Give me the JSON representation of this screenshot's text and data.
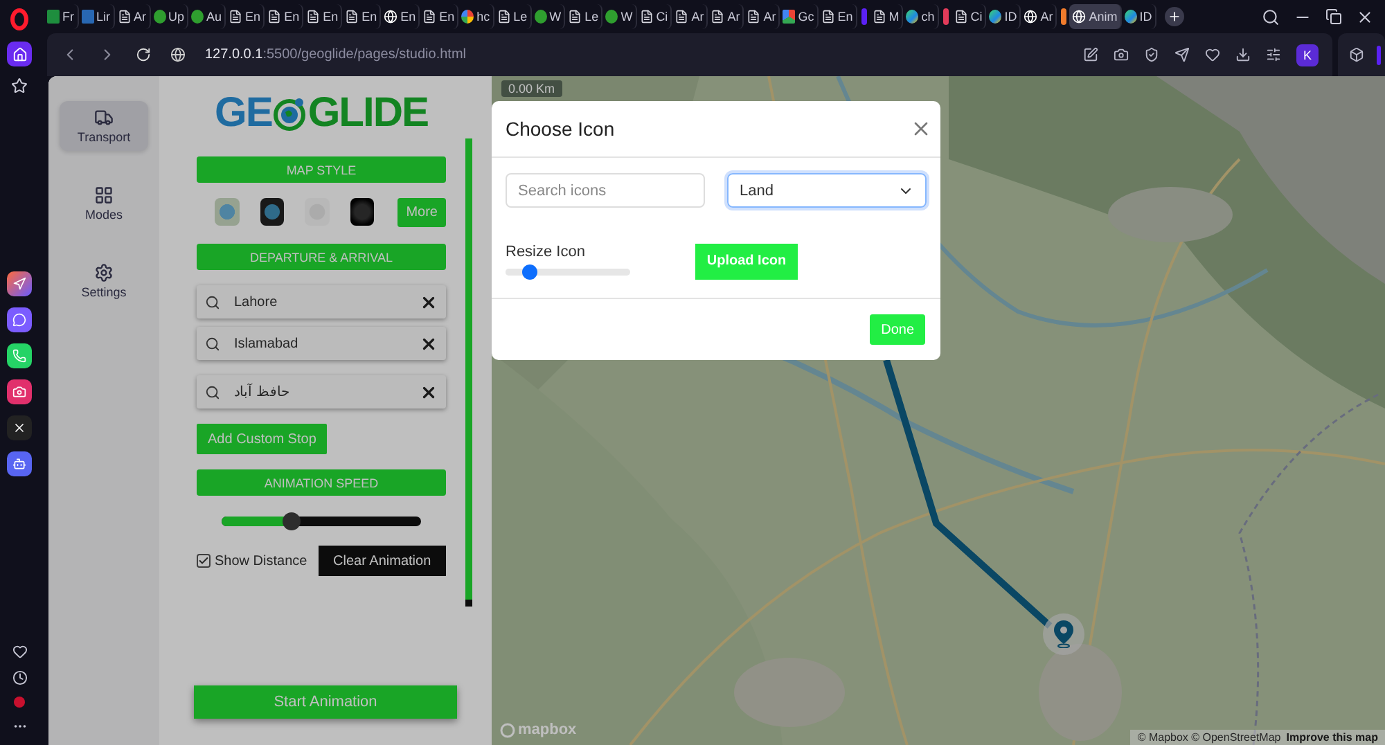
{
  "browser": {
    "tabs": [
      {
        "label": "Fr",
        "kind": "sheet",
        "selected": false
      },
      {
        "label": "Lir",
        "kind": "linkedin",
        "selected": false
      },
      {
        "label": "Ar",
        "kind": "doc",
        "selected": false
      },
      {
        "label": "Up",
        "kind": "upwork",
        "selected": false
      },
      {
        "label": "Au",
        "kind": "upwork",
        "selected": false
      },
      {
        "label": "En",
        "kind": "doc",
        "selected": false
      },
      {
        "label": "En",
        "kind": "doc",
        "selected": false
      },
      {
        "label": "En",
        "kind": "doc",
        "selected": false
      },
      {
        "label": "En",
        "kind": "doc",
        "selected": false
      },
      {
        "label": "En",
        "kind": "globe",
        "selected": false
      },
      {
        "label": "En",
        "kind": "doc",
        "selected": false
      },
      {
        "label": "hc",
        "kind": "google",
        "selected": false
      },
      {
        "label": "Le",
        "kind": "doc",
        "selected": false
      },
      {
        "label": "W",
        "kind": "upwork",
        "selected": false
      },
      {
        "label": "Le",
        "kind": "doc",
        "selected": false
      },
      {
        "label": "W",
        "kind": "upwork",
        "selected": false
      },
      {
        "label": "Ci",
        "kind": "doc",
        "selected": false
      },
      {
        "label": "Ar",
        "kind": "doc",
        "selected": false
      },
      {
        "label": "Ar",
        "kind": "doc",
        "selected": false
      },
      {
        "label": "Ar",
        "kind": "doc",
        "selected": false
      },
      {
        "label": "Gc",
        "kind": "colorful",
        "selected": false
      },
      {
        "label": "En",
        "kind": "doc",
        "selected": false
      },
      {
        "label": "M",
        "kind": "doc",
        "selected": false,
        "color": "#5b21f5"
      },
      {
        "label": "ch",
        "kind": "edge",
        "selected": false
      },
      {
        "label": "Ci",
        "kind": "doc",
        "selected": false,
        "color": "#e23b5a"
      },
      {
        "label": "ID",
        "kind": "edge",
        "selected": false
      },
      {
        "label": "Ar",
        "kind": "globe",
        "selected": false
      },
      {
        "label": "Anim",
        "kind": "globe",
        "selected": true,
        "color": "#f07b2c"
      },
      {
        "label": "ID",
        "kind": "edge",
        "selected": false
      }
    ],
    "url_host": "127.0.0.1",
    "url_rest": ":5500/geoglide/pages/studio.html",
    "profile": "K"
  },
  "nav": [
    {
      "label": "Transport",
      "kind": "truck",
      "selected": true
    },
    {
      "label": "Modes",
      "kind": "grid",
      "selected": false
    },
    {
      "label": "Settings",
      "kind": "gear",
      "selected": false
    }
  ],
  "panel": {
    "logo": {
      "left": "GE",
      "right": "GLIDE"
    },
    "map_style": {
      "heading": "MAP STYLE",
      "styles": [
        {
          "kind": "streets"
        },
        {
          "kind": "satellite"
        },
        {
          "kind": "light"
        },
        {
          "kind": "dark"
        }
      ],
      "more": "More"
    },
    "route": {
      "heading": "DEPARTURE & ARRIVAL",
      "stops": [
        {
          "value": "Lahore"
        },
        {
          "value": "Islamabad"
        },
        {
          "value": "حافظ آباد"
        }
      ],
      "add": "Add Custom Stop"
    },
    "speed": {
      "heading": "ANIMATION SPEED",
      "level": 0.35
    },
    "show_distance": {
      "label": "Show Distance",
      "checked": true
    },
    "clear": "Clear Animation",
    "start": "Start Animation"
  },
  "map": {
    "distance": "0.00 Km",
    "logo": "mapbox",
    "attribution": "© Mapbox © OpenStreetMap",
    "improve": "Improve this map"
  },
  "modal": {
    "title": "Choose Icon",
    "search": {
      "placeholder": "Search icons"
    },
    "category": {
      "value": "Land"
    },
    "resize": {
      "label": "Resize Icon",
      "level": 0.19
    },
    "upload": "Upload Icon",
    "done": "Done"
  }
}
